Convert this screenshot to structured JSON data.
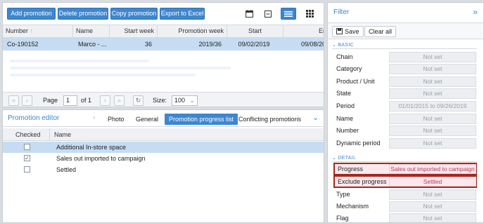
{
  "toolbar": {
    "add_label": "Add promotion",
    "delete_label": "Delete promotion",
    "copy_label": "Copy promotion",
    "export_label": "Export to Excel"
  },
  "grid": {
    "headers": {
      "number": "Number",
      "name": "Name",
      "start_week": "Start week",
      "promotion_week": "Promotion week",
      "start": "Start",
      "end": "End"
    },
    "row": {
      "number": "Co-190152",
      "name": "Marco - ...",
      "start_week": "36",
      "promotion_week": "2019/36",
      "start": "09/02/2019",
      "end": "09/08/20"
    }
  },
  "pager": {
    "page_label": "Page",
    "page_value": "1",
    "of_label": "of 1",
    "size_label": "Size:",
    "size_value": "100"
  },
  "editor": {
    "title": "Promotion editor",
    "tabs": [
      "Photo",
      "General",
      "Promotion progress list",
      "Conflicting promotions"
    ],
    "active_tab": 2,
    "col_checked": "Checked",
    "col_name": "Name",
    "rows": [
      {
        "name": "Additional In-store space",
        "checked": false,
        "selected": true
      },
      {
        "name": "Sales out imported to campaign",
        "checked": true,
        "selected": false
      },
      {
        "name": "Settled",
        "checked": false,
        "selected": false
      }
    ]
  },
  "filter": {
    "title": "Filter",
    "save_label": "Save",
    "clear_label": "Clear all",
    "basic_label": "BASIC",
    "detail_label": "DETAIL",
    "basic": [
      {
        "label": "Chain",
        "value": "Not set"
      },
      {
        "label": "Category",
        "value": "Not set"
      },
      {
        "label": "Product / Unit",
        "value": "Not set"
      },
      {
        "label": "State",
        "value": "Not set"
      },
      {
        "label": "Period",
        "value": "01/01/2015 to 09/26/2019"
      },
      {
        "label": "Name",
        "value": "Not set"
      },
      {
        "label": "Number",
        "value": "Not set"
      },
      {
        "label": "Dynamic period",
        "value": "Not set"
      }
    ],
    "detail": [
      {
        "label": "Progress",
        "value": "Sales out imported to campaign"
      },
      {
        "label": "Exclude progress",
        "value": "Settled"
      },
      {
        "label": "Type",
        "value": "Not set"
      },
      {
        "label": "Mechanism",
        "value": "Not set"
      },
      {
        "label": "Flag",
        "value": "Not set"
      }
    ]
  },
  "colors": {
    "accent": "#3e86cf",
    "selection": "#c6dcf2",
    "highlight_border": "#a6271f"
  }
}
